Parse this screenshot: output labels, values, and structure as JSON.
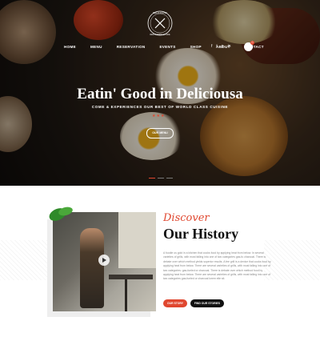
{
  "brand": {
    "name": "DELICIOUSA",
    "tagline": "RESTAURANT & CAFE"
  },
  "nav": {
    "items": [
      "HOME",
      "MENU",
      "RESERVATION",
      "EVENTS",
      "SHOP",
      "ABOUT",
      "CONTACT"
    ],
    "socials": [
      "f",
      "t",
      "p",
      "in"
    ],
    "cart_count": "0"
  },
  "hero": {
    "title": "Eatin' Good in Deliciousa",
    "subtitle": "COME & EXPERIENCES OUR BEST OF WORLD CLASS CUISINE",
    "stars": "★★★",
    "button": "OUR MENU"
  },
  "history": {
    "script_title": "Discover",
    "title": "Our History",
    "paragraph": "A foodie us gold in a kitchen that cooks food by applying heat from below. In several varieties of grills, with most falling into one of two categories gas-fu charcoal. There is debate over which method yields superior results. A fee grill is a device that cooks food by applying heat from below. There are several varieties of grills, with most falling into one of two categories: gas-fueled or charcoal. There is debate over which method food by applying heat from below. There are several varieties of grills, with most falling into one of two categories gas-fueled or charcoal lorem elle sit.",
    "primary_button": "OUR STORY",
    "secondary_button": "FIND OUR STORIES"
  },
  "colors": {
    "accent": "#e0472f",
    "dark": "#111111"
  }
}
